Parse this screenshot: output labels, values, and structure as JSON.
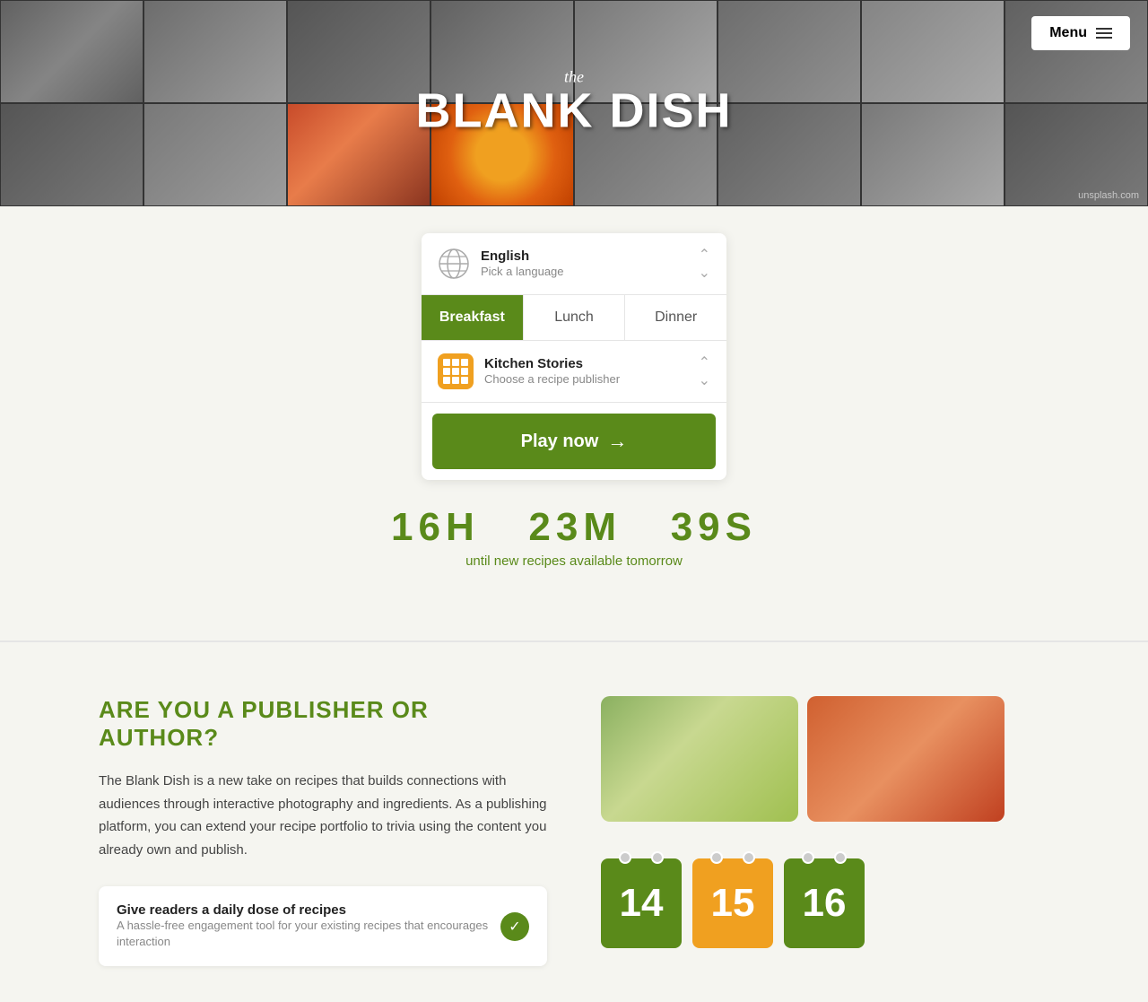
{
  "header": {
    "logo_the": "the",
    "logo_main": "BLANK DISH",
    "menu_label": "Menu",
    "unsplash_credit": "unsplash.com"
  },
  "widget": {
    "language": {
      "name": "English",
      "placeholder": "Pick a language"
    },
    "tabs": [
      {
        "id": "breakfast",
        "label": "Breakfast",
        "active": true
      },
      {
        "id": "lunch",
        "label": "Lunch",
        "active": false
      },
      {
        "id": "dinner",
        "label": "Dinner",
        "active": false
      }
    ],
    "publisher": {
      "name": "Kitchen Stories",
      "placeholder": "Choose a recipe publisher"
    },
    "play_button": "Play now"
  },
  "timer": {
    "hours": "16H",
    "minutes": "23M",
    "seconds": "39S",
    "label": "until new recipes available tomorrow"
  },
  "lower": {
    "heading": "ARE YOU A PUBLISHER OR AUTHOR?",
    "body": "The Blank Dish is a new take on recipes that builds connections with audiences through interactive photography and ingredients. As a publishing platform, you can extend your recipe portfolio to trivia using the content you already own and publish.",
    "feature_title": "Give readers a daily dose of recipes",
    "feature_desc": "A hassle-free engagement tool for your existing recipes that encourages interaction"
  },
  "calendar": {
    "numbers": [
      "14",
      "15",
      "16"
    ]
  }
}
